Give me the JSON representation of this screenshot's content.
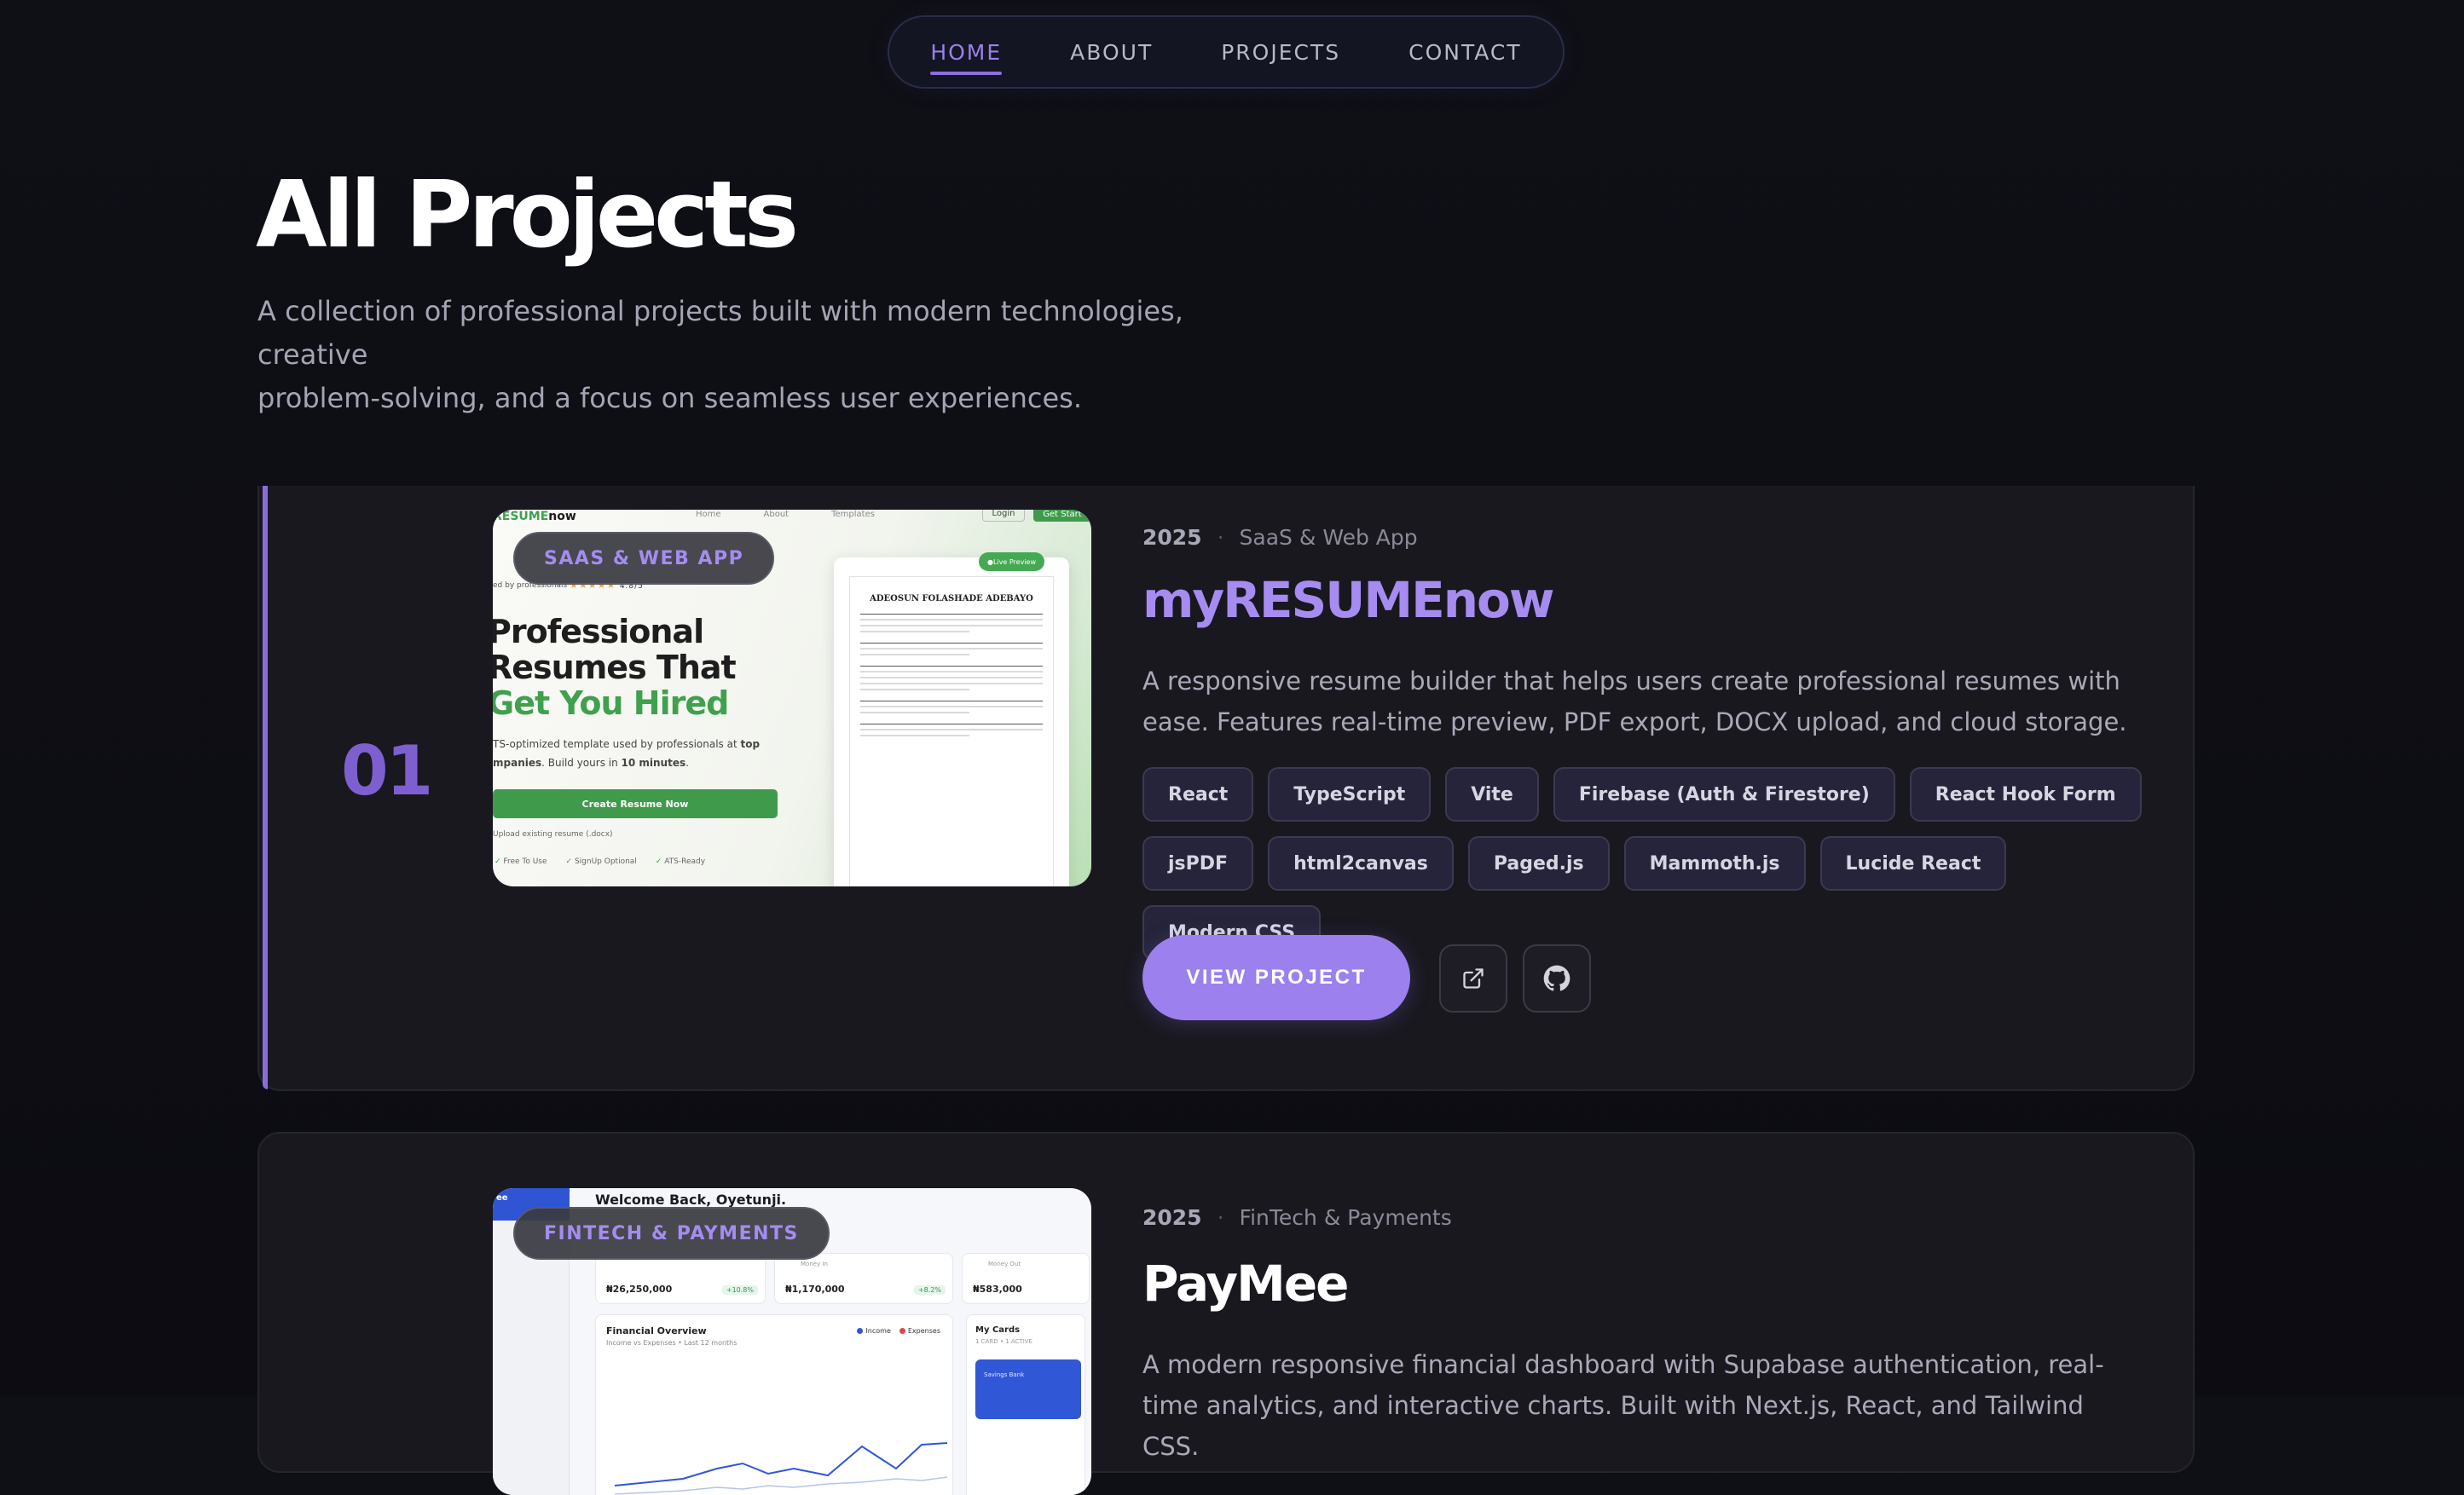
{
  "nav": {
    "items": [
      {
        "label": "HOME",
        "active": true
      },
      {
        "label": "ABOUT",
        "active": false
      },
      {
        "label": "PROJECTS",
        "active": false
      },
      {
        "label": "CONTACT",
        "active": false
      }
    ]
  },
  "header": {
    "title": "All Projects",
    "subtitle_line1": "A collection of professional projects built with modern technologies, creative",
    "subtitle_line2": "problem-solving, and a focus on seamless user experiences."
  },
  "colors": {
    "accent": "#9b80ee",
    "background": "#0f0f16",
    "card": "#19181f"
  },
  "projects": [
    {
      "number": "01",
      "category_pill": "SAAS & WEB APP",
      "year": "2025",
      "category": "SaaS & Web App",
      "title": "myRESUMEnow",
      "description": "A responsive resume builder that helps users create professional resumes with ease. Features real-time preview, PDF export, DOCX upload, and cloud storage.",
      "tags": [
        "React",
        "TypeScript",
        "Vite",
        "Firebase (Auth & Firestore)",
        "React Hook Form",
        "jsPDF",
        "html2canvas",
        "Paged.js",
        "Mammoth.js",
        "Lucide React",
        "Modern CSS"
      ],
      "view_label": "VIEW PROJECT",
      "icons": [
        "external-link-icon",
        "github-icon"
      ],
      "thumbnail": {
        "logo_main": "RESUME",
        "logo_suffix": "now",
        "nav_items": [
          "Home",
          "About",
          "Templates"
        ],
        "login_label": "Login",
        "get_started_label": "Get Start",
        "rated_text": "ed by professionals",
        "stars": "★★★★★",
        "rating": "4.8/5",
        "hero_line1": "Professional",
        "hero_line2": "Resumes That",
        "hero_line3": "Get You Hired",
        "tagline_start": "TS-optimized template used by professionals at ",
        "tagline_bold1": "top",
        "tagline_mid": "mpanies",
        "tagline_end": ". Build yours in ",
        "tagline_bold2": "10 minutes",
        "cta_label": "Create Resume Now",
        "upload_label": "Upload existing resume (.docx)",
        "features": [
          "Free To Use",
          "SignUp Optional",
          "ATS-Ready"
        ],
        "live_preview": "Live Preview",
        "resume_name": "ADEOSUN FOLASHADE ADEBAYO"
      }
    },
    {
      "number": "",
      "category_pill": "FINTECH & PAYMENTS",
      "year": "2025",
      "category": "FinTech & Payments",
      "title": "PayMee",
      "description": "A modern responsive financial dashboard with Supabase authentication, real-time analytics, and interactive charts. Built with Next.js, React, and Tailwind CSS.",
      "thumbnail": {
        "sidebar_brand": "ee",
        "welcome": "Welcome Back, Oyetunji.",
        "stats": [
          {
            "label": "",
            "value": "₦26,250,000",
            "change": "+10.8%"
          },
          {
            "label": "Money In",
            "value": "₦1,170,000",
            "change": "+8.2%"
          },
          {
            "label": "Money Out",
            "value": "₦583,000",
            "change": ""
          }
        ],
        "overview_title": "Financial Overview",
        "overview_subtitle": "Income vs Expenses • Last 12 months",
        "legend_income": "Income",
        "legend_expenses": "Expenses",
        "cards_title": "My Cards",
        "cards_subtitle": "1 CARD • 1 ACTIVE",
        "bank_label": "Savings Bank"
      }
    }
  ]
}
